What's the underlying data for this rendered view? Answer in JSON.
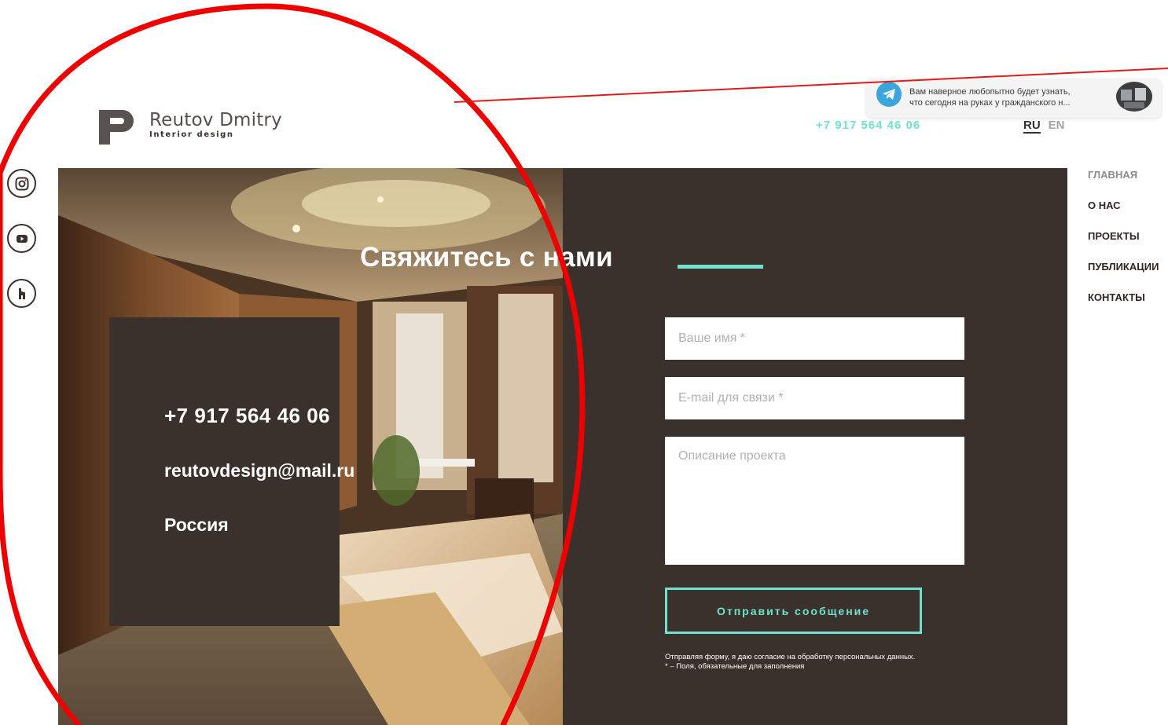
{
  "logo": {
    "name": "Reutov Dmitry",
    "subtitle": "Interior design"
  },
  "header": {
    "phone": "+7 917 564 46 06",
    "lang_ru": "RU",
    "lang_en": "EN"
  },
  "notification": {
    "icon": "telegram-icon",
    "text_line1": "Вам наверное любопытно будет узнать,",
    "text_line2": "что сегодня на руках у гражданского н..."
  },
  "social": [
    "instagram-icon",
    "youtube-icon",
    "houzz-icon"
  ],
  "nav": {
    "items": [
      "ГЛАВНАЯ",
      "О НАС",
      "ПРОЕКТЫ",
      "ПУБЛИКАЦИИ",
      "КОНТАКТЫ"
    ]
  },
  "contact": {
    "heading": "Свяжитесь с нами",
    "phone": "+7 917 564 46 06",
    "email": "reutovdesign@mail.ru",
    "country": "Россия"
  },
  "form": {
    "name_placeholder": "Ваше имя *",
    "email_placeholder": "E-mail для связи *",
    "description_placeholder": "Описание проекта",
    "submit_label": "Отправить сообщение",
    "consent_line1": "Отправляя форму, я даю согласие на обработку персональных данных.",
    "consent_line2": "* – Поля, обязательные для заполнения"
  },
  "colors": {
    "accent": "#6fe2cf",
    "dark": "#3a302c",
    "annotation": "#ee0000"
  }
}
